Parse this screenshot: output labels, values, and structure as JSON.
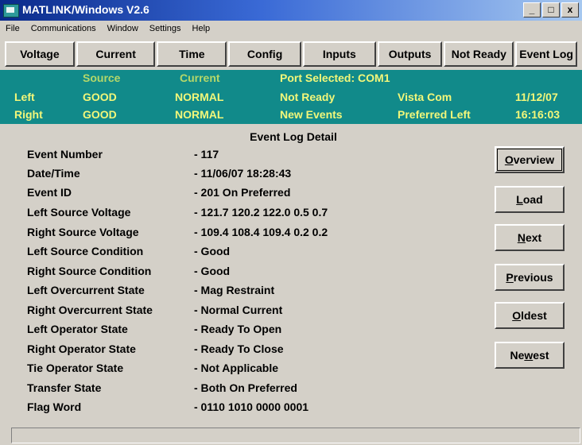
{
  "window": {
    "title": "MATLINK/Windows V2.6",
    "controls": [
      "_",
      "□",
      "x"
    ]
  },
  "menu": [
    "File",
    "Communications",
    "Window",
    "Settings",
    "Help"
  ],
  "toolbar": [
    "Voltage",
    "Current",
    "Time",
    "Config",
    "Inputs",
    "Outputs",
    "Not Ready",
    "Event Log"
  ],
  "status": {
    "source_header": "Source",
    "current_header": "Current",
    "port": "Port Selected: COM1",
    "left": {
      "label": "Left",
      "source": "GOOD",
      "current": "NORMAL",
      "state": "Not Ready",
      "com": "Vista Com",
      "date": "11/12/07"
    },
    "right": {
      "label": "Right",
      "source": "GOOD",
      "current": "NORMAL",
      "state": "New Events",
      "pref": "Preferred Left",
      "time": "16:16:03"
    }
  },
  "detail": {
    "title": "Event Log Detail",
    "rows": [
      {
        "label": "Event Number",
        "value": "- 117"
      },
      {
        "label": "Date/Time",
        "value": "- 11/06/07  18:28:43"
      },
      {
        "label": "Event ID",
        "value": "- 201  On Preferred"
      },
      {
        "label": "Left Source Voltage",
        "value": "- 121.7  120.2  122.0  0.5  0.7"
      },
      {
        "label": "Right Source Voltage",
        "value": "- 109.4  108.4  109.4  0.2  0.2"
      },
      {
        "label": "Left Source Condition",
        "value": "- Good"
      },
      {
        "label": "Right Source Condition",
        "value": "- Good"
      },
      {
        "label": "Left Overcurrent State",
        "value": "- Mag Restraint"
      },
      {
        "label": "Right Overcurrent State",
        "value": "- Normal Current"
      },
      {
        "label": "Left Operator State",
        "value": "- Ready To Open"
      },
      {
        "label": "Right Operator State",
        "value": "- Ready To Close"
      },
      {
        "label": "Tie Operator State",
        "value": "- Not Applicable"
      },
      {
        "label": "Transfer State",
        "value": "- Both On Preferred"
      },
      {
        "label": "Flag Word",
        "value": "- 0110 1010 0000 0001"
      }
    ]
  },
  "buttons": {
    "overview": {
      "m": "O",
      "rest": "verview"
    },
    "load": {
      "m": "L",
      "rest": "oad"
    },
    "next": {
      "pre": "",
      "m": "N",
      "rest": "ext"
    },
    "previous": {
      "m": "P",
      "rest": "revious"
    },
    "oldest": {
      "m": "O",
      "rest": "ldest"
    },
    "newest": {
      "pre": "Ne",
      "m": "w",
      "rest": "est"
    }
  }
}
